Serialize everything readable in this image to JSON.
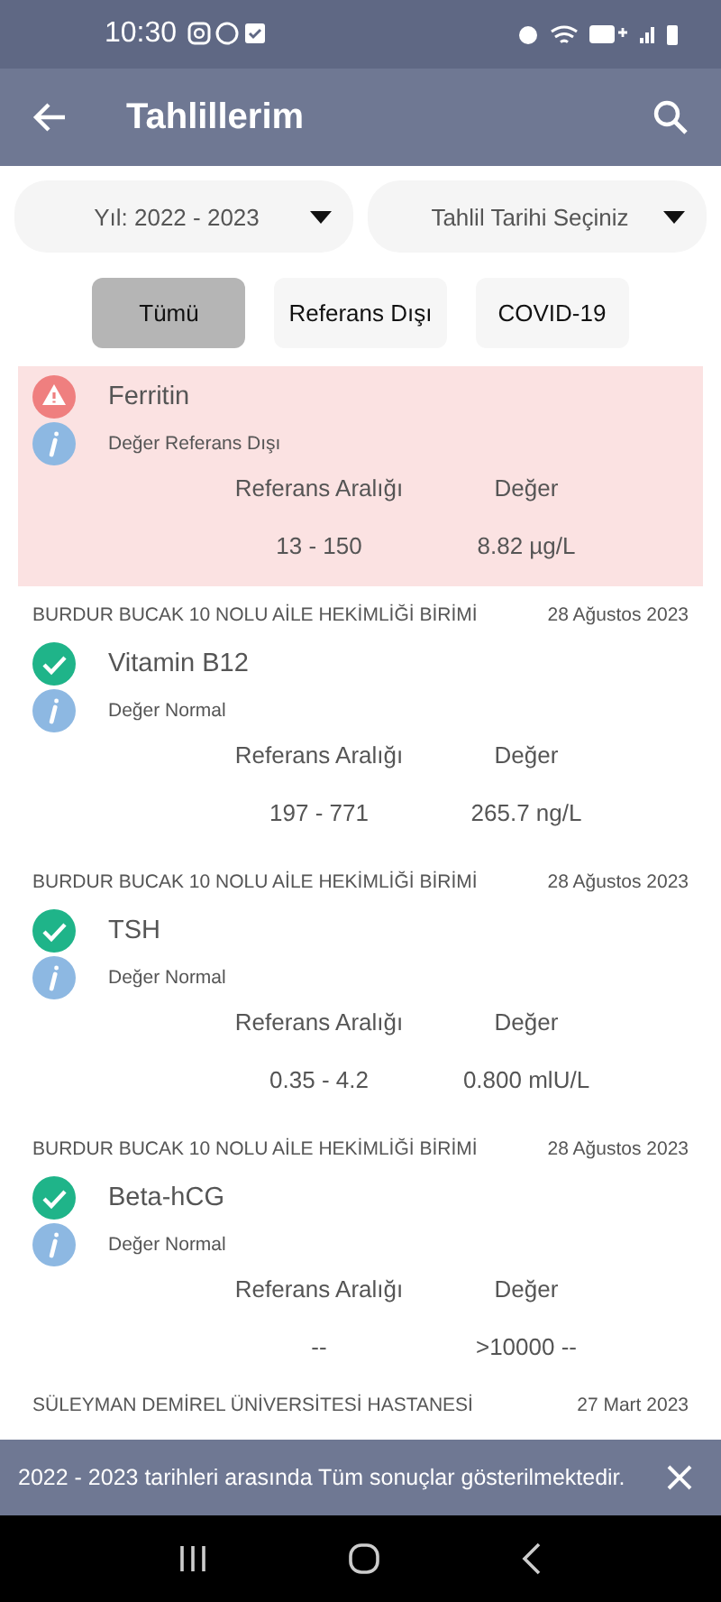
{
  "status_bar": {
    "time": "10:30"
  },
  "app_bar": {
    "title": "Tahlillerim"
  },
  "filters": [
    {
      "label": "Yıl: 2022 - 2023"
    },
    {
      "label": "Tahlil Tarihi Seçiniz"
    }
  ],
  "tabs": [
    {
      "label": "Tümü",
      "selected": true
    },
    {
      "label": "Referans Dışı",
      "selected": false
    },
    {
      "label": "COVID-19",
      "selected": false
    }
  ],
  "results": [
    {
      "kind": "out_of_range",
      "name": "Ferritin",
      "status": "Değer Referans Dışı",
      "range_label": "Referans Aralığı",
      "value_label": "Değer",
      "range": "13 - 150",
      "value": "8.82 µg/L"
    },
    {
      "kind": "normal",
      "lab": "BURDUR BUCAK 10 NOLU AİLE HEKİMLİĞİ BİRİMİ",
      "date": "28 Ağustos 2023",
      "name": "Vitamin B12",
      "status": "Değer Normal",
      "range_label": "Referans Aralığı",
      "value_label": "Değer",
      "range": "197 - 771",
      "value": "265.7 ng/L"
    },
    {
      "kind": "normal",
      "lab": "BURDUR BUCAK 10 NOLU AİLE HEKİMLİĞİ BİRİMİ",
      "date": "28 Ağustos 2023",
      "name": "TSH",
      "status": "Değer Normal",
      "range_label": "Referans Aralığı",
      "value_label": "Değer",
      "range": "0.35 - 4.2",
      "value": "0.800 mlU/L"
    },
    {
      "kind": "normal",
      "lab": "BURDUR BUCAK 10 NOLU AİLE HEKİMLİĞİ BİRİMİ",
      "date": "28 Ağustos 2023",
      "name": "Beta-hCG",
      "status": "Değer Normal",
      "range_label": "Referans Aralığı",
      "value_label": "Değer",
      "range": "--",
      "value": ">10000 --"
    }
  ],
  "next_header": {
    "lab": "SÜLEYMAN DEMİREL ÜNİVERSİTESİ HASTANESİ",
    "date": "27 Mart 2023"
  },
  "snackbar": {
    "message": "2022 - 2023 tarihleri arasında Tüm sonuçlar gösterilmektedir."
  }
}
